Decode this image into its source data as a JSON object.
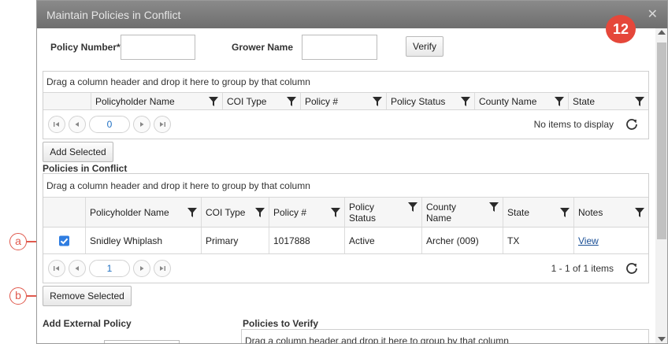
{
  "dialog": {
    "title": "Maintain Policies in Conflict",
    "badge": "12"
  },
  "search": {
    "policy_number_label": "Policy Number*",
    "policy_number_value": "",
    "grower_name_label": "Grower Name",
    "grower_name_value": "",
    "verify_label": "Verify"
  },
  "results_grid": {
    "group_hint": "Drag a column header and drop it here to group by that column",
    "columns": [
      "Policyholder Name",
      "COI Type",
      "Policy #",
      "Policy Status",
      "County Name",
      "State"
    ],
    "page": "0",
    "pager_info": "No items to display"
  },
  "add_selected_label": "Add Selected",
  "conflict_section_label": "Policies in Conflict",
  "conflict_grid": {
    "group_hint": "Drag a column header and drop it here to group by that column",
    "columns": [
      "Policyholder Name",
      "COI Type",
      "Policy #",
      "Policy Status",
      "County Name",
      "State",
      "Notes"
    ],
    "rows": [
      {
        "checked": true,
        "policyholder": "Snidley Whiplash",
        "coi_type": "Primary",
        "policy_no": "1017888",
        "status": "Active",
        "county": "Archer (009)",
        "state": "TX",
        "notes_link": "View"
      }
    ],
    "page": "1",
    "pager_info": "1 - 1 of 1 items"
  },
  "remove_selected_label": "Remove Selected",
  "add_external_label": "Add External Policy",
  "verify_section": {
    "label": "Policies to Verify",
    "group_hint": "Drag a column header and drop it here to group by that column"
  },
  "callouts": {
    "a": "a",
    "b": "b"
  },
  "colors": {
    "badge": "#e5473a",
    "accent": "#2f7de1",
    "link": "#1a4f96",
    "callout": "#e0594d"
  }
}
